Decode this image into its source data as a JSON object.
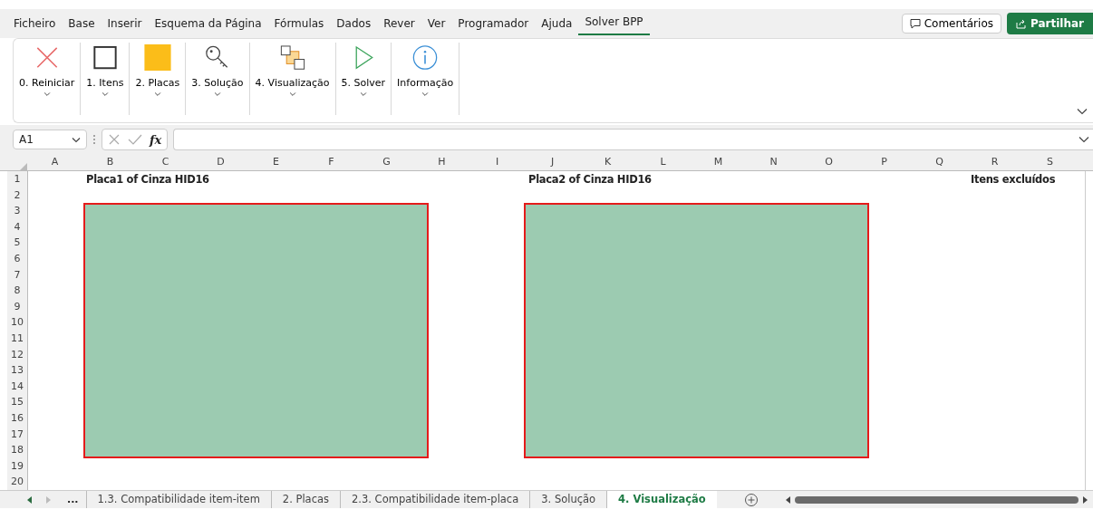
{
  "menu": [
    {
      "label": "Ficheiro",
      "selected": false
    },
    {
      "label": "Base",
      "selected": false
    },
    {
      "label": "Inserir",
      "selected": false
    },
    {
      "label": "Esquema da Página",
      "selected": false
    },
    {
      "label": "Fórmulas",
      "selected": false
    },
    {
      "label": "Dados",
      "selected": false
    },
    {
      "label": "Rever",
      "selected": false
    },
    {
      "label": "Ver",
      "selected": false
    },
    {
      "label": "Programador",
      "selected": false
    },
    {
      "label": "Ajuda",
      "selected": false
    },
    {
      "label": "Solver BPP",
      "selected": true
    }
  ],
  "comments_button": "Comentários",
  "share_button": "Partilhar",
  "ribbon": [
    {
      "kind": "cross",
      "label": "0. Reiniciar"
    },
    {
      "kind": "square",
      "label": "1. Itens"
    },
    {
      "kind": "filled",
      "label": "2. Placas"
    },
    {
      "kind": "key",
      "label": "3. Solução"
    },
    {
      "kind": "layers",
      "label": "4. Visualização"
    },
    {
      "kind": "play",
      "label": "5. Solver"
    },
    {
      "kind": "info",
      "label": "Informação"
    }
  ],
  "name_box": "A1",
  "formula_fx": "fx",
  "columns": [
    "A",
    "B",
    "C",
    "D",
    "E",
    "F",
    "G",
    "H",
    "I",
    "J",
    "K",
    "L",
    "M",
    "N",
    "O",
    "P",
    "Q",
    "R",
    "S"
  ],
  "rows": [
    "1",
    "2",
    "3",
    "4",
    "5",
    "6",
    "7",
    "8",
    "9",
    "10",
    "11",
    "12",
    "13",
    "14",
    "15",
    "16",
    "17",
    "18",
    "19",
    "20"
  ],
  "cells": [
    "Placa1 of Cinza HID16",
    "Placa2 of Cinza HID16",
    "Itens excluídos"
  ],
  "shapes": [
    {
      "kind": "plate"
    },
    {
      "kind": "plate"
    }
  ],
  "sheet_more": "...",
  "sheet_tabs": [
    {
      "label": "1.3. Compatibilidade item-item",
      "selected": false
    },
    {
      "label": "2. Placas",
      "selected": false
    },
    {
      "label": "2.3. Compatibilidade item-placa",
      "selected": false
    },
    {
      "label": "3. Solução",
      "selected": false
    },
    {
      "label": "4. Visualização",
      "selected": true
    }
  ]
}
